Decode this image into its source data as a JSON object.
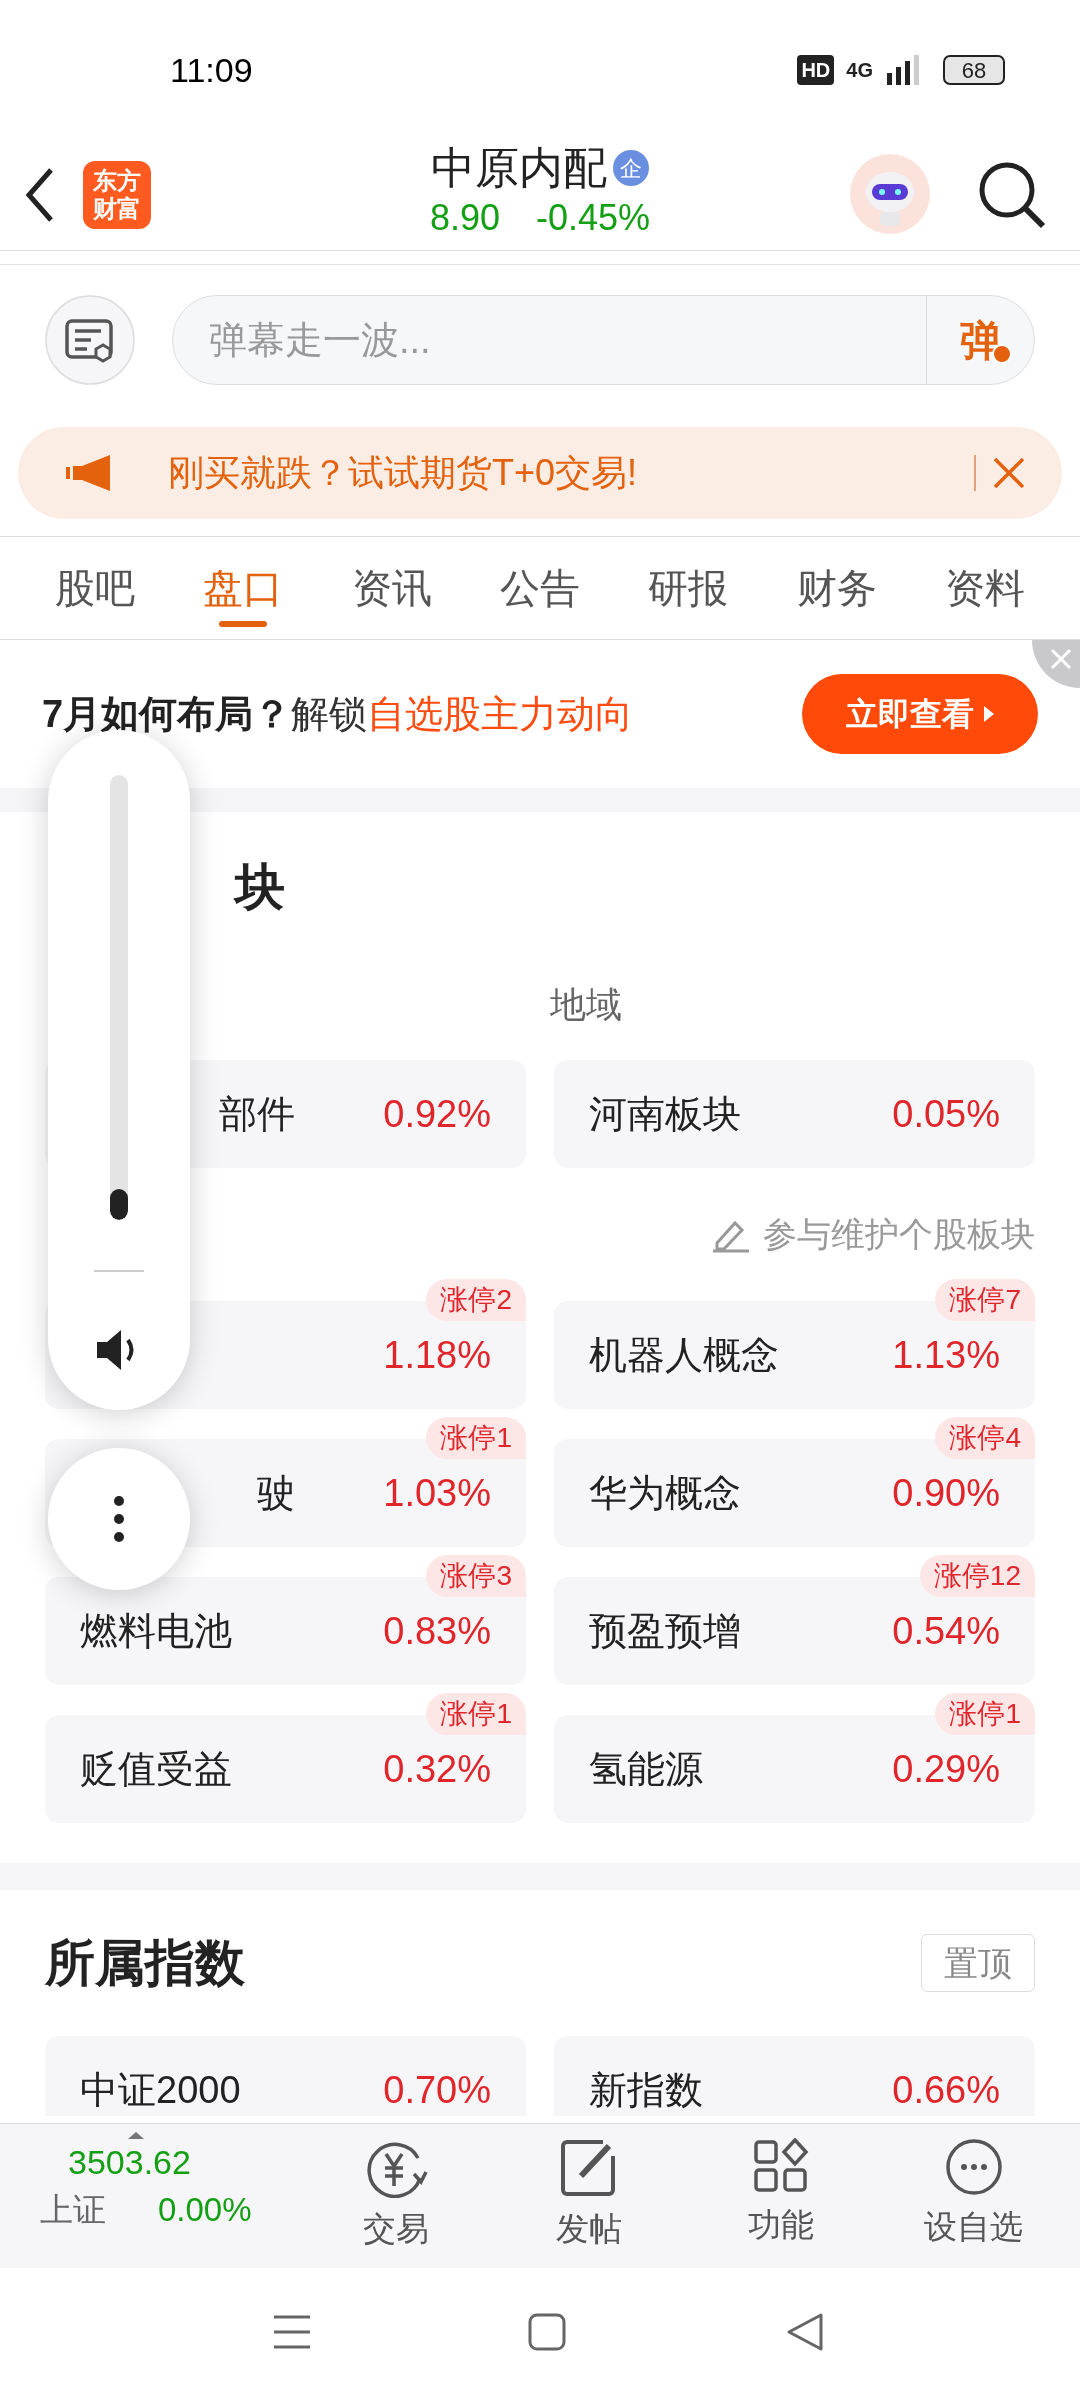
{
  "status_bar": {
    "time": "11:09",
    "hd": "HD",
    "network": "4G",
    "battery": "68"
  },
  "header": {
    "logo_lines": [
      "东方",
      "财富"
    ],
    "title": "中原内配",
    "badge": "企",
    "price": "8.90",
    "change": "-0.45%"
  },
  "comment_bar": {
    "placeholder": "弹幕走一波...",
    "send_label": "弹"
  },
  "notice": {
    "text": "刚买就跌？试试期货T+0交易!"
  },
  "tabs": [
    {
      "label": "股吧",
      "selected": false
    },
    {
      "label": "盘口",
      "selected": true
    },
    {
      "label": "资讯",
      "selected": false
    },
    {
      "label": "公告",
      "selected": false
    },
    {
      "label": "研报",
      "selected": false
    },
    {
      "label": "财务",
      "selected": false
    },
    {
      "label": "资料",
      "selected": false
    }
  ],
  "promo": {
    "parts": [
      {
        "text": "7月如何布局？",
        "kind": "bold"
      },
      {
        "text": "解锁",
        "kind": "plain"
      },
      {
        "text": "自选股主力动向",
        "kind": "accent"
      }
    ],
    "button": "立即查看"
  },
  "sectors": {
    "title": "块",
    "title_partly_hidden": true,
    "region_label": "地域",
    "top_cards": [
      {
        "name": "部件",
        "change": "0.92%",
        "partly_hidden": true
      },
      {
        "name": "河南板块",
        "change": "0.05%"
      }
    ],
    "edit_link": "参与维护个股板块",
    "concepts": [
      {
        "change": "1.18%",
        "limit_up": "涨停2"
      },
      {
        "name": "机器人概念",
        "change": "1.13%",
        "limit_up": "涨停7"
      },
      {
        "name": "驶",
        "change": "1.03%",
        "limit_up": "涨停1",
        "partly_hidden": true
      },
      {
        "name": "华为概念",
        "change": "0.90%",
        "limit_up": "涨停4"
      },
      {
        "name": "燃料电池",
        "change": "0.83%",
        "limit_up": "涨停3"
      },
      {
        "name": "预盈预增",
        "change": "0.54%",
        "limit_up": "涨停12"
      },
      {
        "name": "贬值受益",
        "change": "0.32%",
        "limit_up": "涨停1"
      },
      {
        "name": "氢能源",
        "change": "0.29%",
        "limit_up": "涨停1"
      }
    ]
  },
  "indices": {
    "title": "所属指数",
    "pin_button": "置顶",
    "cards": [
      {
        "name": "中证2000",
        "change": "0.70%"
      },
      {
        "name": "新指数",
        "change": "0.66%"
      }
    ]
  },
  "bottom_bar": {
    "index_value": "3503.62",
    "index_name": "上证",
    "index_change": "0.00%",
    "items": [
      {
        "label": "交易",
        "kind": "trade"
      },
      {
        "label": "发帖",
        "kind": "post"
      },
      {
        "label": "功能",
        "kind": "apps"
      },
      {
        "label": "设自选",
        "kind": "more"
      }
    ]
  },
  "volume_overlay": {
    "level": 0.07
  }
}
